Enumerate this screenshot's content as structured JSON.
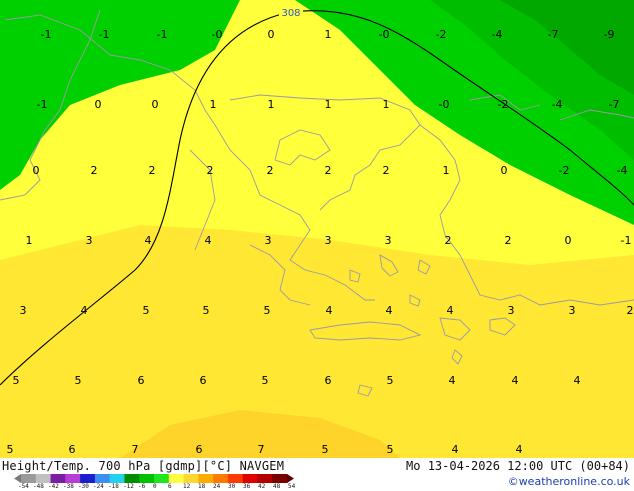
{
  "map": {
    "contour_label": "308",
    "values": [
      [
        "-1",
        "-1",
        "-1",
        "-0",
        "0",
        "1",
        "-0",
        "-2",
        "-4",
        "-7",
        "-9"
      ],
      [
        "-1",
        "0",
        "0",
        "1",
        "1",
        "1",
        "1",
        "-0",
        "-2",
        "-4",
        "-7"
      ],
      [
        "0",
        "2",
        "2",
        "2",
        "2",
        "2",
        "2",
        "1",
        "0",
        "-2",
        "-4"
      ],
      [
        "1",
        "3",
        "4",
        "4",
        "3",
        "3",
        "3",
        "2",
        "2",
        "0",
        "-1"
      ],
      [
        "3",
        "4",
        "5",
        "5",
        "5",
        "4",
        "4",
        "4",
        "3",
        "3",
        "2"
      ],
      [
        "5",
        "5",
        "6",
        "6",
        "5",
        "6",
        "5",
        "4",
        "4",
        "4"
      ],
      [
        "5",
        "6",
        "7",
        "6",
        "7",
        "5",
        "5",
        "4",
        "4"
      ]
    ]
  },
  "footer": {
    "title": "Height/Temp. 700 hPa [gdmp][°C] NAVGEM",
    "datetime": "Mo 13-04-2026 12:00 UTC (00+84)",
    "credit": "©weatheronline.co.uk"
  },
  "colorbar": {
    "ticks": [
      "-54",
      "-48",
      "-42",
      "-38",
      "-30",
      "-24",
      "-18",
      "-12",
      "-6",
      "0",
      "6",
      "12",
      "18",
      "24",
      "30",
      "36",
      "42",
      "48",
      "54"
    ],
    "colors": [
      "#9a9a9a",
      "#c0c0c0",
      "#7b1fa2",
      "#b83cd6",
      "#1d1dd0",
      "#3a8ff0",
      "#23d0f0",
      "#008c00",
      "#00c000",
      "#1ee61e",
      "#ffff40",
      "#ffd733",
      "#ffab00",
      "#ff7a00",
      "#ff3c00",
      "#e00000",
      "#b00000",
      "#7a0000"
    ]
  }
}
